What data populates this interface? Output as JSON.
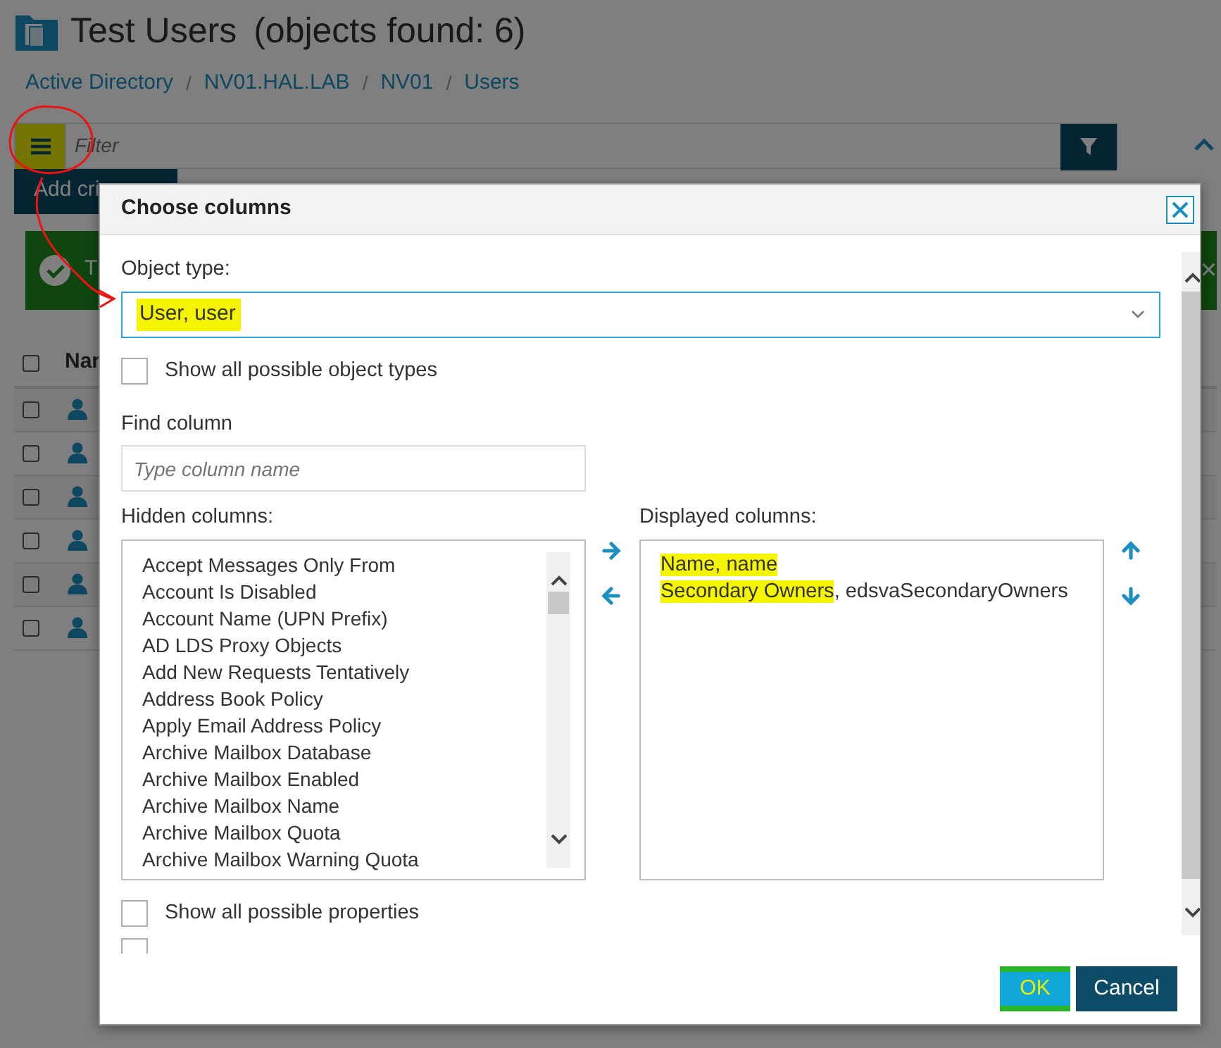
{
  "page": {
    "title": "Test Users",
    "count": "(objects found: 6)",
    "breadcrumb": [
      "Active Directory",
      "NV01.HAL.LAB",
      "NV01",
      "Users"
    ],
    "breadcrumb_separator": "/",
    "filter": {
      "placeholder": "Filter",
      "menu_highlighted": true
    },
    "add_button": "Add cri",
    "alert": {
      "text": "T",
      "close": "×"
    },
    "table": {
      "column": "Nar",
      "header_checked": false,
      "rows": [
        {
          "checked": false
        },
        {
          "checked": false
        },
        {
          "checked": false
        },
        {
          "checked": false
        },
        {
          "checked": false
        },
        {
          "checked": false
        }
      ]
    }
  },
  "dialog": {
    "title": "Choose columns",
    "object_type": {
      "label": "Object type:",
      "value": "User, user",
      "highlighted": true
    },
    "show_all_types": {
      "label": "Show all possible object types",
      "checked": false
    },
    "find": {
      "label": "Find column",
      "placeholder": "Type column name"
    },
    "hidden": {
      "label": "Hidden columns:",
      "items": [
        "Accept Messages Only From",
        "Account Is Disabled",
        "Account Name (UPN Prefix)",
        "AD LDS Proxy Objects",
        "Add New Requests Tentatively",
        "Address Book Policy",
        "Apply Email Address Policy",
        "Archive Mailbox Database",
        "Archive Mailbox Enabled",
        "Archive Mailbox Name",
        "Archive Mailbox Quota",
        "Archive Mailbox Warning Quota"
      ]
    },
    "displayed": {
      "label": "Displayed columns:",
      "items": [
        {
          "highlighted": "Name, name"
        },
        {
          "highlighted": "Secondary Owners",
          "rest": ", edsvaSecondaryOwners"
        }
      ]
    },
    "show_all_properties": {
      "label": "Show all possible properties",
      "checked": false
    },
    "extra_checkbox": {
      "checked": false
    },
    "buttons": [
      {
        "label": "OK",
        "kind": "primary",
        "highlighted": true
      },
      {
        "label": "Cancel",
        "kind": "secondary",
        "highlighted": false
      }
    ]
  }
}
